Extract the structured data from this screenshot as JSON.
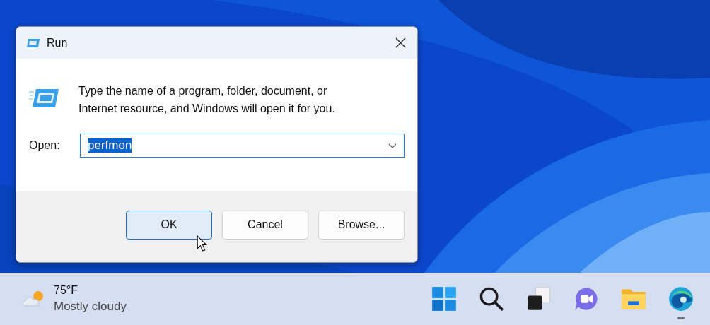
{
  "dialog": {
    "title": "Run",
    "message": "Type the name of a program, folder, document, or Internet resource, and Windows will open it for you.",
    "open_label": "Open:",
    "open_value": "perfmon",
    "value_selected": true,
    "buttons": [
      {
        "label": "OK",
        "default": true
      },
      {
        "label": "Cancel",
        "default": false
      },
      {
        "label": "Browse...",
        "default": false
      }
    ]
  },
  "taskbar": {
    "weather": {
      "temperature": "75°F",
      "condition": "Mostly cloudy"
    },
    "apps": [
      {
        "kind": "start",
        "running": false
      },
      {
        "kind": "search",
        "running": false
      },
      {
        "kind": "taskview",
        "running": false
      },
      {
        "kind": "chat",
        "running": false
      },
      {
        "kind": "explorer",
        "running": false
      },
      {
        "kind": "edge",
        "running": true
      }
    ]
  }
}
